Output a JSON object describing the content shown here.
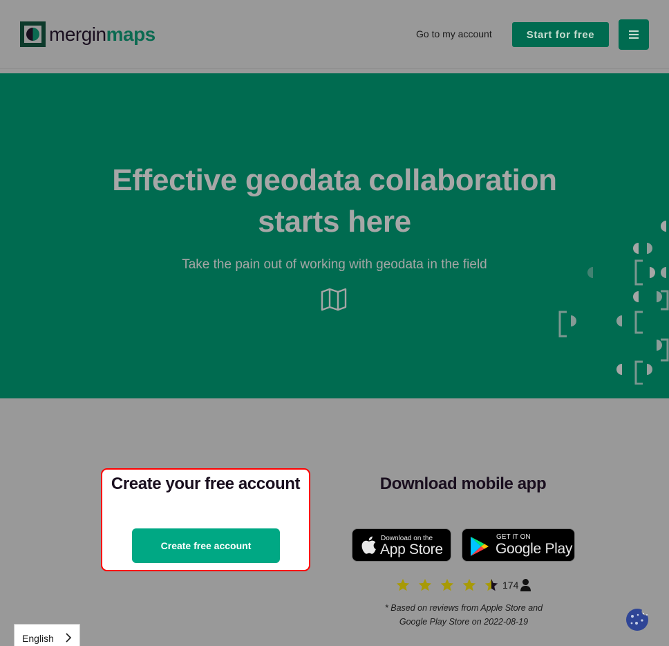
{
  "header": {
    "logo_text_light": "mergin",
    "logo_text_bold": "maps",
    "account_link": "Go to my account",
    "start_button": "Start for free",
    "menu_icon": "hamburger-menu-icon"
  },
  "hero": {
    "title_bold": "Effective",
    "title_rest": " geodata collaboration starts here",
    "subtitle": "Take the pain out of working with geodata in the field",
    "icon": "map-icon"
  },
  "signup": {
    "title": "Create your free account",
    "button": "Create free account"
  },
  "download": {
    "title": "Download mobile app",
    "apple_small": "Download on the",
    "apple_big": "App Store",
    "google_small": "GET IT ON",
    "google_big": "Google Play",
    "rating_stars": 4.5,
    "rating_max": 5,
    "rating_count": "174",
    "note_line1": "* Based on reviews from Apple Store and",
    "note_line2": "Google Play Store on 2022-08-19"
  },
  "language": {
    "label": "English"
  },
  "colors": {
    "brand_green": "#006b50",
    "button_green": "#00a884",
    "star_gold": "#a89a06",
    "highlight_red": "#ff0000"
  }
}
